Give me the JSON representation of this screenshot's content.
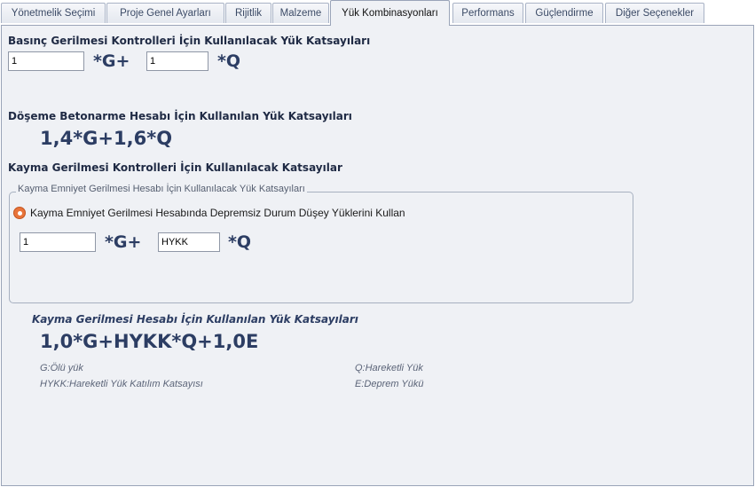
{
  "tabs": [
    {
      "label": "Yönetmelik Seçimi"
    },
    {
      "label": "Proje Genel Ayarları"
    },
    {
      "label": "Rijitlik"
    },
    {
      "label": "Malzeme"
    },
    {
      "label": "Yük Kombinasyonları"
    },
    {
      "label": "Performans"
    },
    {
      "label": "Güçlendirme"
    },
    {
      "label": "Diğer Seçenekler"
    }
  ],
  "basinc": {
    "title": "Basınç Gerilmesi  Kontrolleri İçin Kullanılacak Yük Katsayıları",
    "g_value": "1",
    "g_suffix": "*G+",
    "q_value": "1",
    "q_suffix": "*Q"
  },
  "doseme": {
    "title": "Döşeme Betonarme Hesabı İçin Kullanılan Yük Katsayıları",
    "formula": "1,4*G+1,6*Q"
  },
  "kayma": {
    "title": "Kayma Gerilmesi Kontrolleri İçin Kullanılacak Katsayılar",
    "group_title": "Kayma Emniyet Gerilmesi Hesabı İçin Kullanılacak Yük Katsayıları",
    "radio_label": "Kayma Emniyet Gerilmesi Hesabında Depremsiz Durum Düşey Yüklerini Kullan",
    "radio_checked": true,
    "g_value": "1",
    "g_suffix": "*G+",
    "q_value": "HYKK",
    "q_suffix": "*Q"
  },
  "kayma_hesap": {
    "title": "Kayma Gerilmesi Hesabı İçin Kullanılan Yük Katsayıları",
    "formula": "1,0*G+HYKK*Q+1,0E"
  },
  "legend": {
    "g": "G:Ölü yük",
    "q": "Q:Hareketli Yük",
    "hykk": "HYKK:Hareketli Yük Katılım Katsayısı",
    "e": "E:Deprem Yükü"
  },
  "colors": {
    "accent_radio": "#e8743b",
    "panel_bg": "#eff1f5",
    "heading_text": "#2c3d63"
  }
}
